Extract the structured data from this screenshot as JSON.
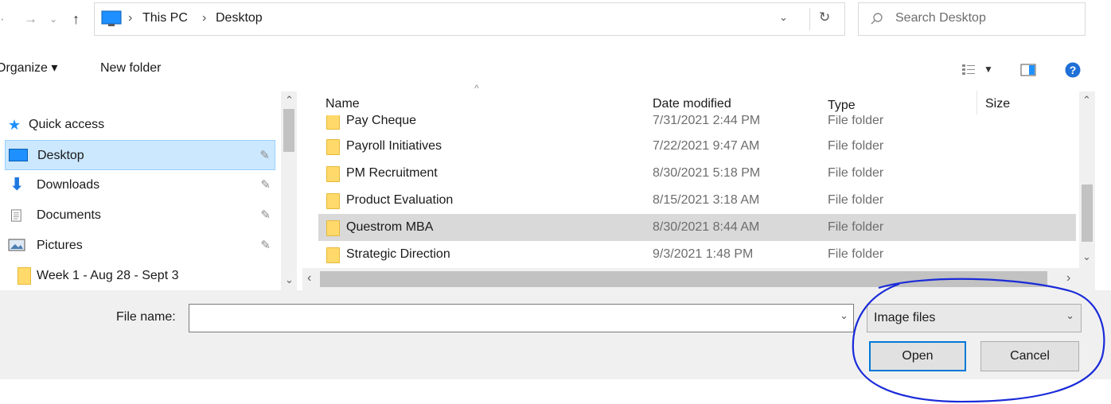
{
  "breadcrumb": [
    "This PC",
    "Desktop"
  ],
  "search": {
    "placeholder": "Search Desktop"
  },
  "toolbar": {
    "organize_label": "Organize ▾",
    "new_folder_label": "New folder"
  },
  "sidebar": {
    "items": [
      {
        "label": "Quick access",
        "icon": "star-icon"
      },
      {
        "label": "Desktop",
        "icon": "desktop-icon",
        "pinned": true,
        "selected": true
      },
      {
        "label": "Downloads",
        "icon": "download-arrow-icon",
        "pinned": true
      },
      {
        "label": "Documents",
        "icon": "document-icon",
        "pinned": true
      },
      {
        "label": "Pictures",
        "icon": "pictures-icon",
        "pinned": true
      },
      {
        "label": "Week 1 - Aug 28 - Sept 3",
        "icon": "folder-icon"
      }
    ]
  },
  "file_list": {
    "columns": [
      "Name",
      "Date modified",
      "Type",
      "Size"
    ],
    "rows": [
      {
        "name": "Pay Cheque",
        "date": "7/31/2021 2:44 PM",
        "type": "File folder"
      },
      {
        "name": "Payroll Initiatives",
        "date": "7/22/2021 9:47 AM",
        "type": "File folder"
      },
      {
        "name": "PM Recruitment",
        "date": "8/30/2021 5:18 PM",
        "type": "File folder"
      },
      {
        "name": "Product Evaluation",
        "date": "8/15/2021 3:18 AM",
        "type": "File folder"
      },
      {
        "name": "Questrom MBA",
        "date": "8/30/2021 8:44 AM",
        "type": "File folder",
        "selected": true
      },
      {
        "name": "Strategic Direction",
        "date": "9/3/2021 1:48 PM",
        "type": "File folder"
      }
    ]
  },
  "filename": {
    "label": "File name:",
    "value": ""
  },
  "filetype": {
    "selected": "Image files"
  },
  "buttons": {
    "open_label": "Open",
    "cancel_label": "Cancel"
  },
  "colors": {
    "selection": "#cce8ff",
    "default_button_border": "#0078d7",
    "annotation": "#1a2bd8",
    "help": "#1f6fd6"
  }
}
